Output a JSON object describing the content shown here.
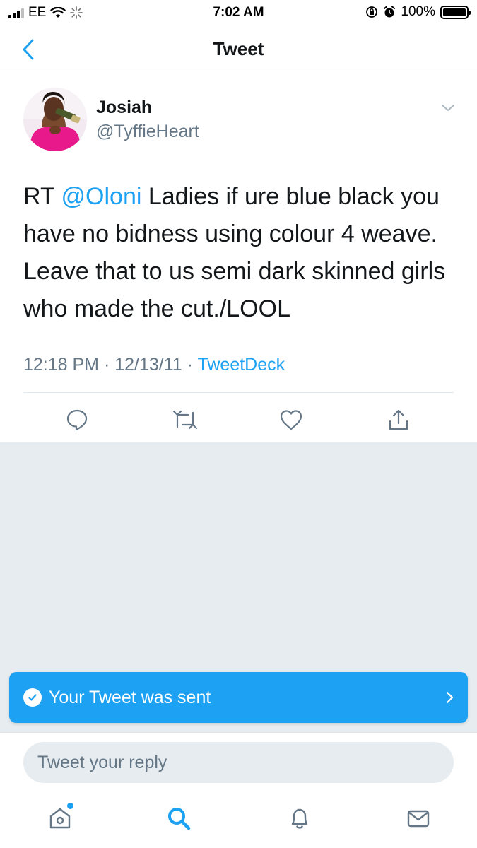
{
  "status_bar": {
    "carrier": "EE",
    "time": "7:02 AM",
    "battery": "100%"
  },
  "nav": {
    "title": "Tweet"
  },
  "tweet": {
    "author_name": "Josiah",
    "author_handle": "@TyffieHeart",
    "text_prefix": "RT ",
    "mention": "@Oloni",
    "text_body": " Ladies if ure blue black you have no bidness using colour 4 weave. Leave that to us semi dark skinned girls who made the cut./LOOL",
    "time": "12:18 PM",
    "date": "12/13/11",
    "meta_separator": " · ",
    "source": "TweetDeck"
  },
  "toast": {
    "message": "Your Tweet was sent"
  },
  "reply": {
    "placeholder": "Tweet your reply"
  },
  "colors": {
    "accent": "#1da1f2",
    "secondary_text": "#657786",
    "background_gray": "#e6ecf0"
  },
  "icons": {
    "back": "chevron-left-icon",
    "caret": "chevron-down-icon",
    "reply": "speech-bubble-icon",
    "retweet": "retweet-icon",
    "like": "heart-icon",
    "share": "share-icon",
    "toast_check": "check-circle-icon",
    "toast_arrow": "chevron-right-icon",
    "tab_home": "home-icon",
    "tab_search": "search-icon",
    "tab_notifications": "bell-icon",
    "tab_messages": "envelope-icon"
  }
}
